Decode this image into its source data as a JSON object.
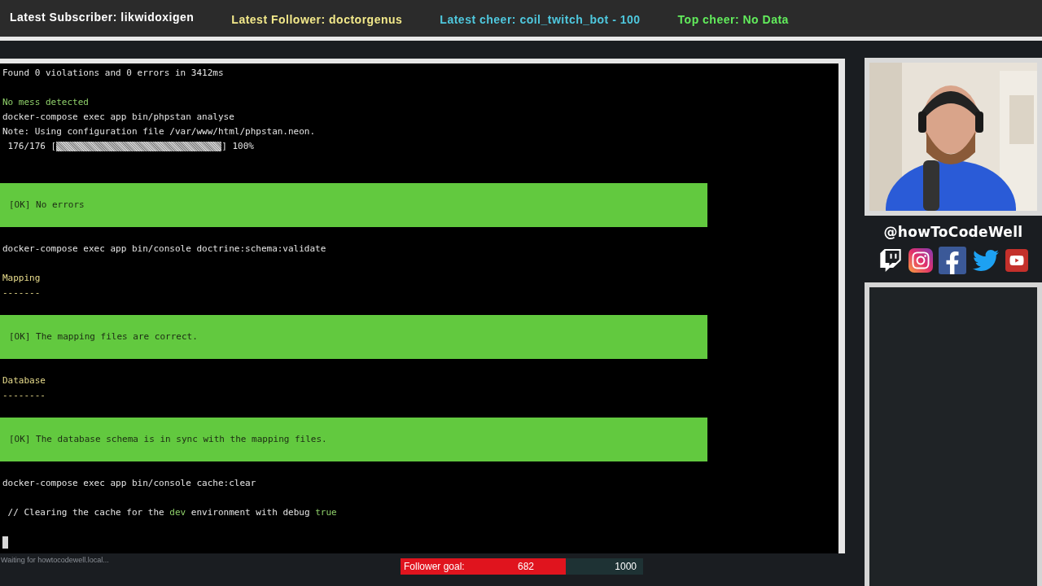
{
  "top_bar": [
    {
      "label": "Latest Subscriber: likwidoxigen",
      "color": "#ffffff"
    },
    {
      "label": "Latest Follower: doctorgenus",
      "color": "#f2e88a"
    },
    {
      "label": "Latest cheer: coil_twitch_bot - 100",
      "color": "#4fc8de"
    },
    {
      "label": "Top cheer: No Data",
      "color": "#62ec5c"
    }
  ],
  "terminal": {
    "lines": [
      {
        "kind": "plain",
        "text": "Found 0 violations and 0 errors in 3412ms"
      },
      {
        "kind": "blank"
      },
      {
        "kind": "success",
        "text": "No mess detected"
      },
      {
        "kind": "plain",
        "text": "docker-compose exec app bin/phpstan analyse"
      },
      {
        "kind": "plain",
        "text": "Note: Using configuration file /var/www/html/phpstan.neon."
      },
      {
        "kind": "progress",
        "prefix": " 176/176 [",
        "suffix": "] 100%",
        "level": 1
      },
      {
        "kind": "blank"
      },
      {
        "kind": "blank"
      },
      {
        "kind": "ok",
        "text": "[OK] No errors"
      },
      {
        "kind": "blank"
      },
      {
        "kind": "plain",
        "text": "docker-compose exec app bin/console doctrine:schema:validate"
      },
      {
        "kind": "blank"
      },
      {
        "kind": "heading",
        "text": "Mapping"
      },
      {
        "kind": "rule",
        "text": "-------"
      },
      {
        "kind": "blank"
      },
      {
        "kind": "ok",
        "text": "[OK] The mapping files are correct."
      },
      {
        "kind": "blank"
      },
      {
        "kind": "heading",
        "text": "Database"
      },
      {
        "kind": "rule",
        "text": "--------"
      },
      {
        "kind": "blank"
      },
      {
        "kind": "ok",
        "text": "[OK] The database schema is in sync with the mapping files."
      },
      {
        "kind": "blank"
      },
      {
        "kind": "plain",
        "text": "docker-compose exec app bin/console cache:clear"
      },
      {
        "kind": "blank"
      },
      {
        "kind": "mixed",
        "segments": [
          {
            "text": " // Clearing the cache for the ",
            "highlight": false
          },
          {
            "text": "dev",
            "highlight": true
          },
          {
            "text": " environment with debug ",
            "highlight": false
          },
          {
            "text": "true",
            "highlight": true
          }
        ]
      },
      {
        "kind": "blank"
      },
      {
        "kind": "cursor"
      }
    ]
  },
  "status": "Waiting for howtocodewell.local...",
  "handle": "@howToCodeWell",
  "socials": [
    {
      "kind": "twitch"
    },
    {
      "kind": "instagram"
    },
    {
      "kind": "facebook"
    },
    {
      "kind": "twitter"
    },
    {
      "kind": "youtube"
    }
  ],
  "follower_goal": {
    "label": "Follower goal:",
    "current": "682",
    "target": "1000",
    "level": 0.682
  }
}
